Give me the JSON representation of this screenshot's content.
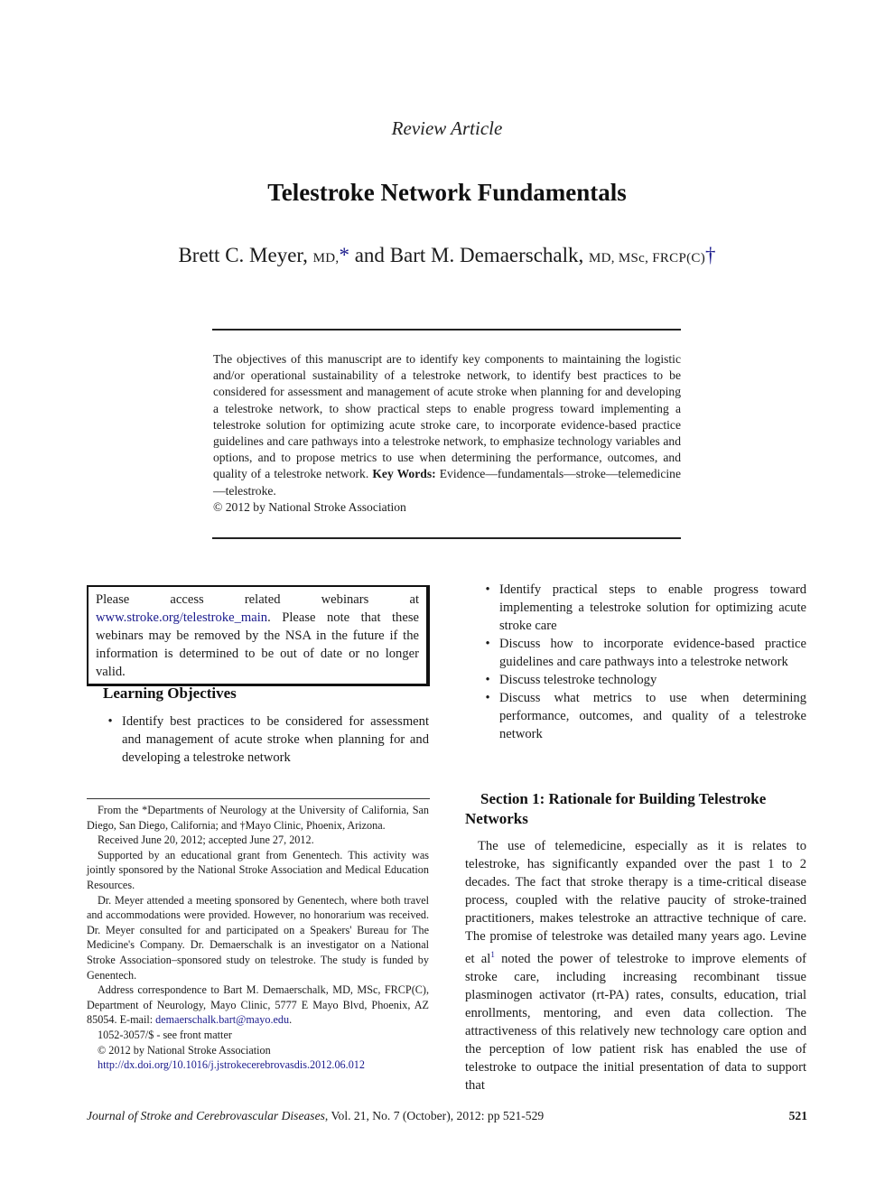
{
  "header": {
    "article_type": "Review Article",
    "title": "Telestroke Network Fundamentals",
    "authors": {
      "author1_name": "Brett C. Meyer, ",
      "author1_degrees": "MD,",
      "author1_mark": "*",
      "conjunction": " and ",
      "author2_name": "Bart M. Demaerschalk, ",
      "author2_degrees": "MD, MSc, FRCP(C)",
      "author2_mark": "†"
    }
  },
  "abstract": {
    "text": "The objectives of this manuscript are to identify key components to maintaining the logistic and/or operational sustainability of a telestroke network, to identify best practices to be considered for assessment and management of acute stroke when planning for and developing a telestroke network, to show practical steps to enable progress toward implementing a telestroke solution for optimizing acute stroke care, to incorporate evidence-based practice guidelines and care pathways into a telestroke network, to emphasize technology variables and options, and to propose metrics to use when determining the performance, outcomes, and quality of a telestroke network.",
    "keywords_label": "Key Words:",
    "keywords": " Evidence—fundamentals—stroke—telemedicine—telestroke.",
    "copyright": "© 2012 by National Stroke Association"
  },
  "notice": {
    "prefix": "Please access related webinars at ",
    "link": "www.stroke.org/telestroke_main",
    "suffix": ". Please note that these webinars may be removed by the NSA in the future if the information is determined to be out of date or no longer valid."
  },
  "learning_objectives": {
    "title": "Learning Objectives",
    "bullet": "•",
    "items": [
      "Identify best practices to be considered for assessment and management of acute stroke when planning for and developing a telestroke network",
      "Identify practical steps to enable progress toward implementing a telestroke solution for optimizing acute stroke care",
      "Discuss how to incorporate evidence-based practice guidelines and care pathways into a telestroke network",
      "Discuss telestroke technology",
      "Discuss what metrics to use when determining performance, outcomes, and quality of a telestroke network"
    ]
  },
  "footnotes": {
    "affiliation": "From the *Departments of Neurology at the University of California, San Diego, San Diego, California; and †Mayo Clinic, Phoenix, Arizona.",
    "received": "Received June 20, 2012; accepted June 27, 2012.",
    "support": "Supported by an educational grant from Genentech. This activity was jointly sponsored by the National Stroke Association and Medical Education Resources.",
    "disclosure": "Dr. Meyer attended a meeting sponsored by Genentech, where both travel and accommodations were provided. However, no honorarium was received. Dr. Meyer consulted for and participated on a Speakers' Bureau for The Medicine's Company. Dr. Demaerschalk is an investigator on a National Stroke Association–sponsored study on telestroke. The study is funded by Genentech.",
    "address_prefix": "Address correspondence to Bart M. Demaerschalk, MD, MSc, FRCP(C), Department of Neurology, Mayo Clinic, 5777 E Mayo Blvd, Phoenix, AZ 85054. E-mail: ",
    "email": "demaerschalk.bart@mayo.edu",
    "address_suffix": ".",
    "issn": "1052-3057/$ - see front matter",
    "copyright": "© 2012 by National Stroke Association",
    "doi": "http://dx.doi.org/10.1016/j.jstrokecerebrovasdis.2012.06.012"
  },
  "section1": {
    "title": "Section 1: Rationale for Building Telestroke Networks",
    "para_part1": "The use of telemedicine, especially as it is relates to telestroke, has significantly expanded over the past 1 to 2 decades. The fact that stroke therapy is a time-critical disease process, coupled with the relative paucity of stroke-trained practitioners, makes telestroke an attractive technique of care. The promise of telestroke was detailed many years ago. Levine et al",
    "ref": "1",
    "para_part2": " noted the power of telestroke to improve elements of stroke care, including increasing recombinant tissue plasminogen activator (rt-PA) rates, consults, education, trial enrollments, mentoring, and even data collection. The attractiveness of this relatively new technology care option and the perception of low patient risk has enabled the use of telestroke to outpace the initial presentation of data to support that"
  },
  "footer": {
    "journal": "Journal of Stroke and Cerebrovascular Diseases",
    "citation": ", Vol. 21, No. 7 (October), 2012: pp 521-529",
    "page_number": "521"
  }
}
